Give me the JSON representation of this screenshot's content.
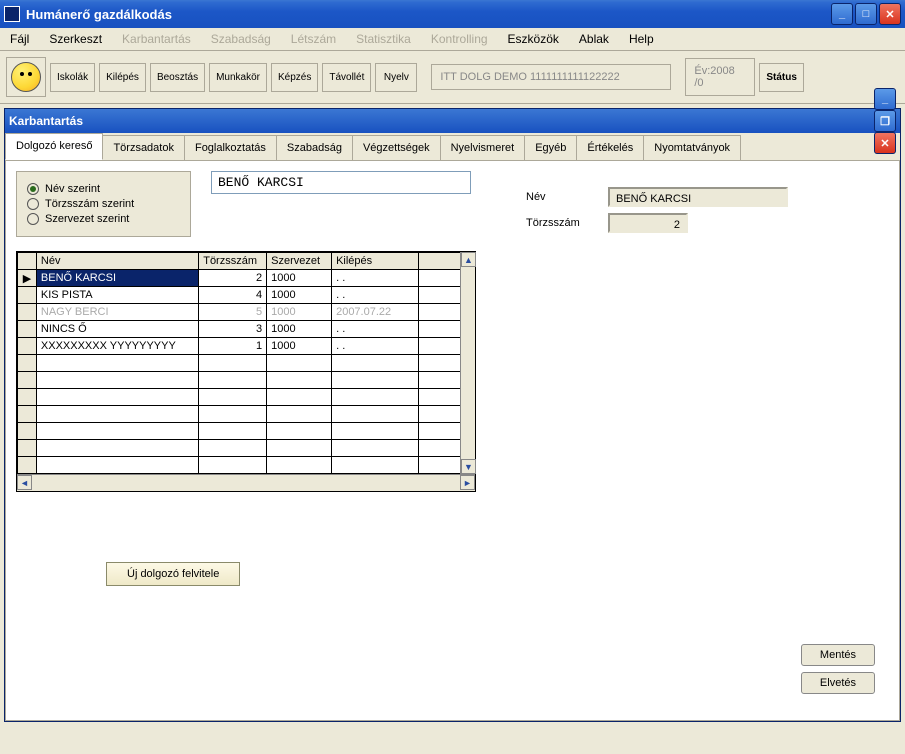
{
  "app": {
    "title": "Humánerő gazdálkodás"
  },
  "menu": {
    "items": [
      {
        "label": "Fájl",
        "enabled": true
      },
      {
        "label": "Szerkeszt",
        "enabled": true
      },
      {
        "label": "Karbantartás",
        "enabled": false
      },
      {
        "label": "Szabadság",
        "enabled": false
      },
      {
        "label": "Létszám",
        "enabled": false
      },
      {
        "label": "Statisztika",
        "enabled": false
      },
      {
        "label": "Kontrolling",
        "enabled": false
      },
      {
        "label": "Eszközök",
        "enabled": true
      },
      {
        "label": "Ablak",
        "enabled": true
      },
      {
        "label": "Help",
        "enabled": true
      }
    ]
  },
  "toolbar": {
    "buttons": [
      "Iskolák",
      "Kilépés",
      "Beosztás",
      "Munkakör",
      "Képzés",
      "Távollét",
      "Nyelv"
    ],
    "info_field": "ITT DOLG DEMO 1111111111122222",
    "year_field": "Év:2008  /0",
    "status_btn": "Státus"
  },
  "child": {
    "title": "Karbantartás"
  },
  "tabs": {
    "items": [
      "Dolgozó kereső",
      "Törzsadatok",
      "Foglalkoztatás",
      "Szabadság",
      "Végzettségek",
      "Nyelvismeret",
      "Egyéb",
      "Értékelés",
      "Nyomtatványok"
    ],
    "active_index": 0
  },
  "search": {
    "radios": [
      {
        "label": "Név szerint",
        "checked": true
      },
      {
        "label": "Törzsszám szerint",
        "checked": false
      },
      {
        "label": "Szervezet szerint",
        "checked": false
      }
    ],
    "input_value": "BENŐ KARCSI"
  },
  "detail": {
    "name_label": "Név",
    "name_value": "BENŐ KARCSI",
    "torzs_label": "Törzsszám",
    "torzs_value": "2"
  },
  "grid": {
    "headers": [
      "Név",
      "Törzsszám",
      "Szervezet",
      "Kilépés"
    ],
    "rows": [
      {
        "name": "BENŐ KARCSI",
        "torzs": "2",
        "szerv": "1000",
        "kilep": ". .",
        "selected": true,
        "faded": false
      },
      {
        "name": "KIS PISTA",
        "torzs": "4",
        "szerv": "1000",
        "kilep": ". .",
        "selected": false,
        "faded": false
      },
      {
        "name": "NAGY BERCI",
        "torzs": "5",
        "szerv": "1000",
        "kilep": "2007.07.22",
        "selected": false,
        "faded": true
      },
      {
        "name": "NINCS Ő",
        "torzs": "3",
        "szerv": "1000",
        "kilep": ". .",
        "selected": false,
        "faded": false
      },
      {
        "name": "XXXXXXXXX YYYYYYYYY",
        "torzs": "1",
        "szerv": "1000",
        "kilep": ". .",
        "selected": false,
        "faded": false
      }
    ],
    "empty_rows": 7
  },
  "buttons": {
    "new_employee": "Új dolgozó felvitele",
    "save": "Mentés",
    "discard": "Elvetés"
  }
}
